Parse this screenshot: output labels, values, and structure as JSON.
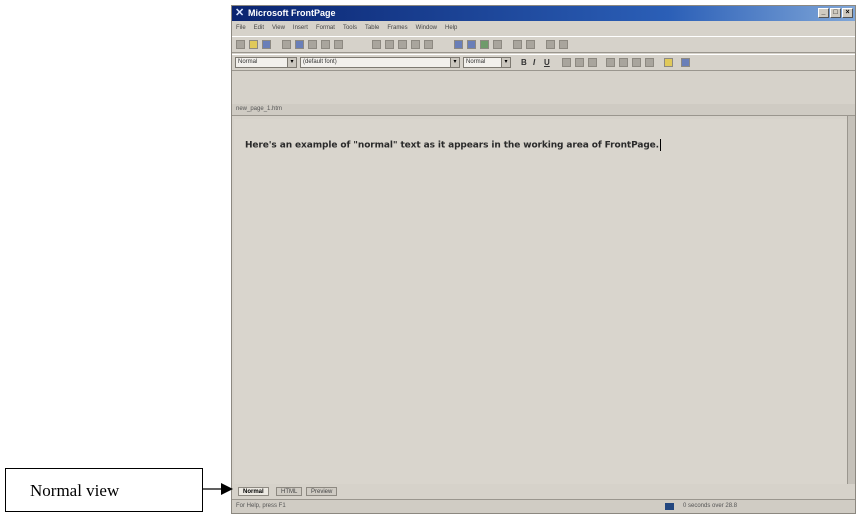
{
  "window": {
    "title": "Microsoft FrontPage",
    "controls": [
      "_",
      "□",
      "×"
    ]
  },
  "menu": [
    "File",
    "Edit",
    "View",
    "Insert",
    "Format",
    "Tools",
    "Table",
    "Frames",
    "Window",
    "Help"
  ],
  "format_bar": {
    "style": "Normal",
    "font": "(default font)",
    "size": "Normal",
    "bold": "B",
    "italic": "I",
    "underline": "U"
  },
  "document": {
    "tab": "new_page_1.htm",
    "text": "Here's an example of \"normal\" text as it appears in the working area of FrontPage."
  },
  "view_tabs": [
    "Normal",
    "HTML",
    "Preview"
  ],
  "status": {
    "left": "For Help, press F1",
    "right": "0 seconds over 28.8"
  },
  "callout": {
    "label": "Normal view"
  }
}
